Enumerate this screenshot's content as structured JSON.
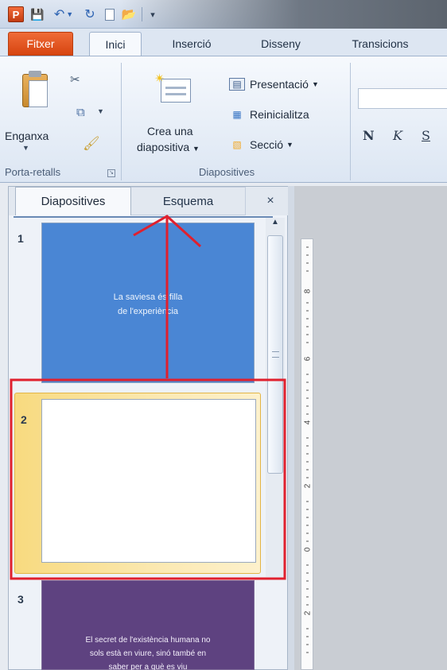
{
  "quick_access": {
    "app_logo": "P",
    "icons": [
      "powerpoint-logo-icon",
      "save-icon",
      "undo-icon",
      "redo-icon",
      "new-icon",
      "open-folder-icon",
      "customize-toolbar-icon"
    ]
  },
  "tabs": [
    {
      "label": "Fitxer"
    },
    {
      "label": "Inici"
    },
    {
      "label": "Inserció"
    },
    {
      "label": "Disseny"
    },
    {
      "label": "Transicions"
    }
  ],
  "ribbon": {
    "clipboard": {
      "paste_label": "Enganxa",
      "group_label": "Porta-retalls"
    },
    "slides": {
      "new_slide_line1": "Crea una",
      "new_slide_line2": "diapositiva",
      "layout_label": "Presentació",
      "reset_label": "Reinicialitza",
      "section_label": "Secció",
      "group_label": "Diapositives"
    },
    "font": {
      "bold": "N",
      "italic": "K",
      "underline": "S"
    }
  },
  "pane": {
    "tab_slides": "Diapositives",
    "tab_outline": "Esquema",
    "close": "×"
  },
  "slides": [
    {
      "number": "1",
      "text_line1": "La saviesa és filla",
      "text_line2": "de l'experiència",
      "color": "#4a86d4"
    },
    {
      "number": "2",
      "text_line1": "",
      "color": "#ffffff"
    },
    {
      "number": "3",
      "text_line1": "El secret de l'existència humana no",
      "text_line2": "sols està en viure, sinó també en",
      "text_line3": "saber per a què es viu",
      "color": "#5e4280"
    }
  ],
  "ruler": {
    "labels": [
      "8",
      "6",
      "4",
      "2",
      "0",
      "2"
    ]
  },
  "annotation_color": "#e0202e"
}
